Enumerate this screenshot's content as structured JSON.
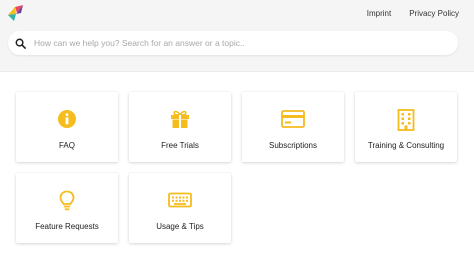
{
  "header": {
    "nav": {
      "imprint": "Imprint",
      "privacy": "Privacy Policy"
    }
  },
  "search": {
    "placeholder": "How can we help you? Search for an answer or a topic..",
    "value": ""
  },
  "accent_color": "#f5bc1e",
  "cards": [
    {
      "label": "FAQ",
      "icon": "info-icon"
    },
    {
      "label": "Free Trials",
      "icon": "gift-icon"
    },
    {
      "label": "Subscriptions",
      "icon": "credit-card-icon"
    },
    {
      "label": "Training & Consulting",
      "icon": "building-icon"
    },
    {
      "label": "Feature Requests",
      "icon": "lightbulb-icon"
    },
    {
      "label": "Usage & Tips",
      "icon": "keyboard-icon"
    }
  ]
}
